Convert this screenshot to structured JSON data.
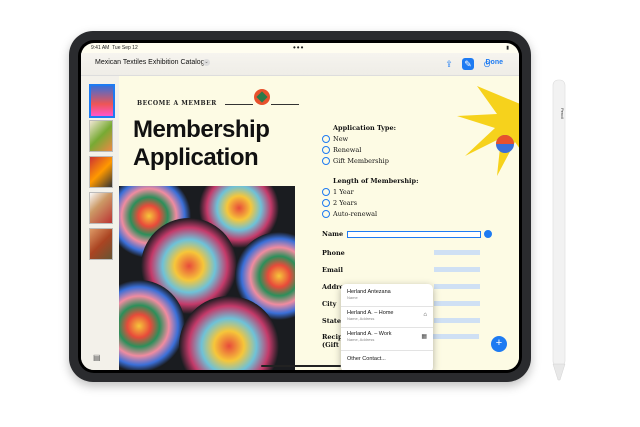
{
  "status": {
    "time": "9:41 AM",
    "date": "Tue Sep 12",
    "dots": "•••",
    "battery": "100%"
  },
  "toolbar": {
    "title": "Mexican Textiles Exhibition Catalog",
    "done": "Done"
  },
  "page": {
    "become_member": "BECOME A MEMBER",
    "heading_line1": "Membership",
    "heading_line2": "Application"
  },
  "form": {
    "application_type": {
      "title": "Application Type:",
      "options": [
        "New",
        "Renewal",
        "Gift Membership"
      ]
    },
    "length": {
      "title": "Length of Membership:",
      "options": [
        "1 Year",
        "2 Years",
        "Auto-renewal"
      ]
    },
    "fields": [
      "Name",
      "Phone",
      "Email",
      "Address",
      "City",
      "State"
    ],
    "recipient_line1": "Recipient's Name",
    "recipient_line2": "(Gift Membership)"
  },
  "autofill": {
    "items": [
      {
        "title": "Herland Antezana",
        "sub": "Name"
      },
      {
        "title": "Herland A. – Home",
        "sub": "Name, Address"
      },
      {
        "title": "Herland A. – Work",
        "sub": "Name, Address"
      }
    ],
    "other": "Other Contact..."
  },
  "pencil": {
    "label": "Pencil"
  },
  "colors": {
    "accent": "#1e7bf2",
    "sunburst": "#f6d21c",
    "emblem": "#e8512c"
  }
}
